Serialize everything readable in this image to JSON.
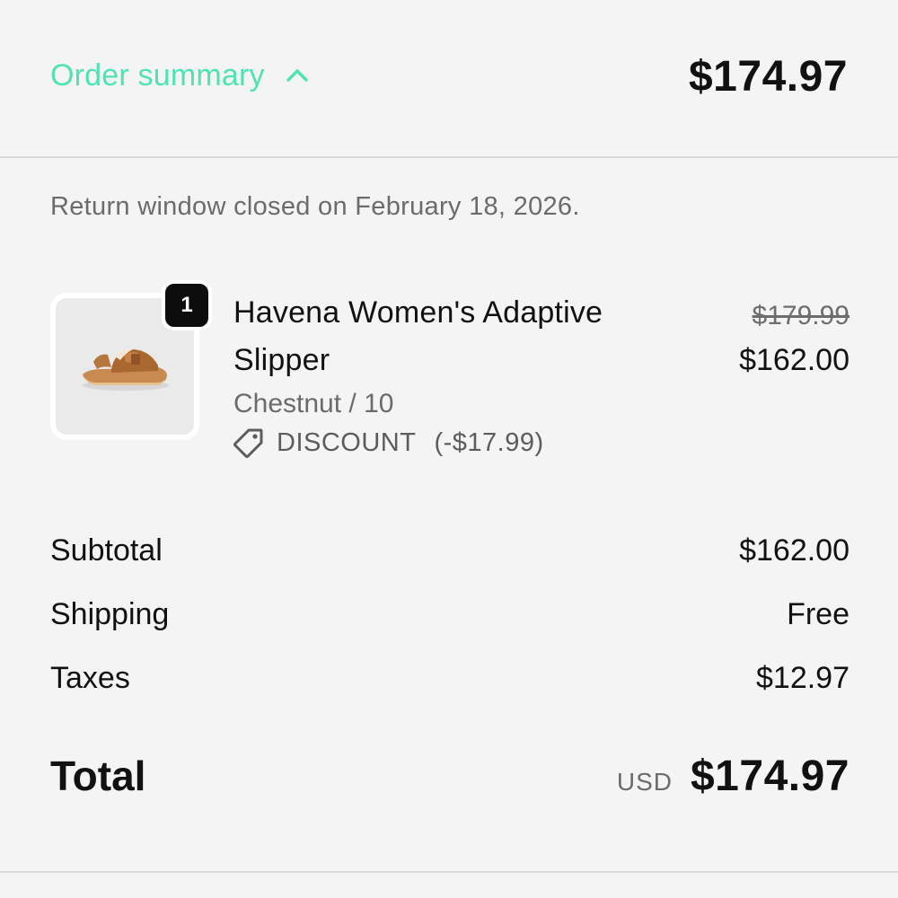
{
  "header": {
    "toggle_label": "Order summary",
    "toggle_icon": "chevron-up-icon",
    "total": "$174.97"
  },
  "notice": "Return window closed on February 18, 2026.",
  "line_item": {
    "quantity": "1",
    "title": "Havena Women's Adaptive Slipper",
    "variant": "Chestnut / 10",
    "discount_label": "DISCOUNT",
    "discount_amount": "(-$17.99)",
    "discount_icon": "tag-icon",
    "price_original": "$179.99",
    "price_current": "$162.00",
    "image_icon": "slipper-image"
  },
  "totals": {
    "subtotal_label": "Subtotal",
    "subtotal_value": "$162.00",
    "shipping_label": "Shipping",
    "shipping_value": "Free",
    "taxes_label": "Taxes",
    "taxes_value": "$12.97",
    "total_label": "Total",
    "currency": "USD",
    "total_value": "$174.97"
  },
  "colors": {
    "accent": "#4fe3b3",
    "background": "#f4f4f4",
    "text": "#111111",
    "muted": "#6b6b6b"
  }
}
